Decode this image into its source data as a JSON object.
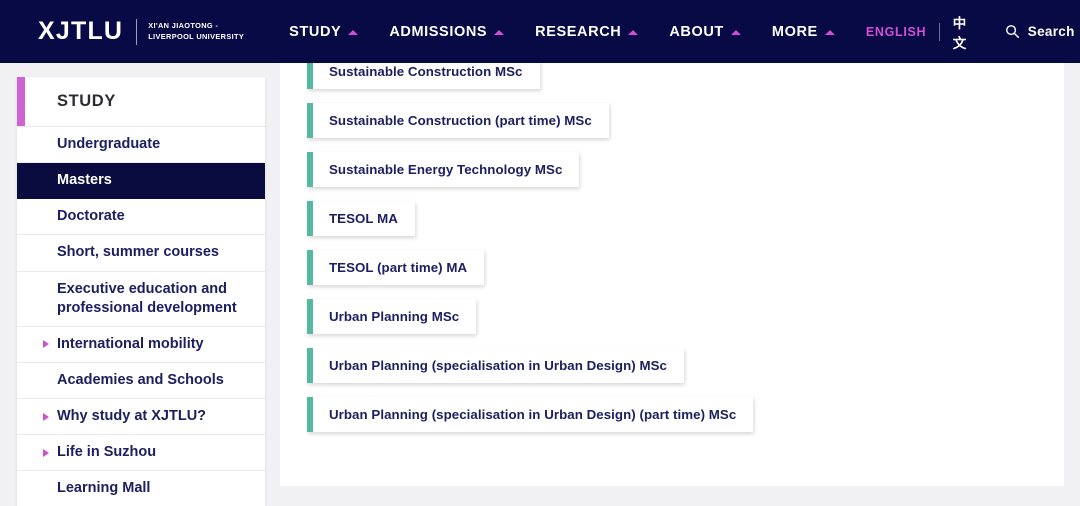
{
  "header": {
    "logo": {
      "mark": "XJTLU",
      "sub_line1": "XI'AN JIAOTONG -",
      "sub_line2": "LIVERPOOL UNIVERSITY"
    },
    "nav": [
      {
        "label": "STUDY"
      },
      {
        "label": "ADMISSIONS"
      },
      {
        "label": "RESEARCH"
      },
      {
        "label": "ABOUT"
      },
      {
        "label": "MORE"
      }
    ],
    "language": {
      "english": "ENGLISH",
      "chinese": "中文"
    },
    "search": {
      "label": "Search",
      "icon": "search-icon"
    },
    "colors": {
      "background": "#080a45",
      "accent_pink": "#cf4fd0",
      "active_language": "#d34fd6"
    }
  },
  "sidebar": {
    "title": "STUDY",
    "accent_color": "#cf63d6",
    "active_background": "#0a0b3f",
    "items": [
      {
        "label": "Undergraduate",
        "active": false,
        "has_arrow": false
      },
      {
        "label": "Masters",
        "active": true,
        "has_arrow": false
      },
      {
        "label": "Doctorate",
        "active": false,
        "has_arrow": false
      },
      {
        "label": "Short, summer courses",
        "active": false,
        "has_arrow": false
      },
      {
        "label": "Executive education and professional development",
        "active": false,
        "has_arrow": false
      },
      {
        "label": "International mobility",
        "active": false,
        "has_arrow": true
      },
      {
        "label": "Academies and Schools",
        "active": false,
        "has_arrow": false
      },
      {
        "label": "Why study at XJTLU?",
        "active": false,
        "has_arrow": true
      },
      {
        "label": "Life in Suzhou",
        "active": false,
        "has_arrow": true
      },
      {
        "label": "Learning Mall",
        "active": false,
        "has_arrow": false
      }
    ]
  },
  "main": {
    "accent_color": "#55b8a2",
    "programmes": [
      {
        "label": "Sustainable Construction MSc"
      },
      {
        "label": "Sustainable Construction (part time) MSc"
      },
      {
        "label": "Sustainable Energy Technology MSc"
      },
      {
        "label": "TESOL MA"
      },
      {
        "label": "TESOL (part time) MA"
      },
      {
        "label": "Urban Planning MSc"
      },
      {
        "label": "Urban Planning (specialisation in Urban Design) MSc"
      },
      {
        "label": "Urban Planning (specialisation in Urban Design) (part time) MSc"
      }
    ]
  }
}
